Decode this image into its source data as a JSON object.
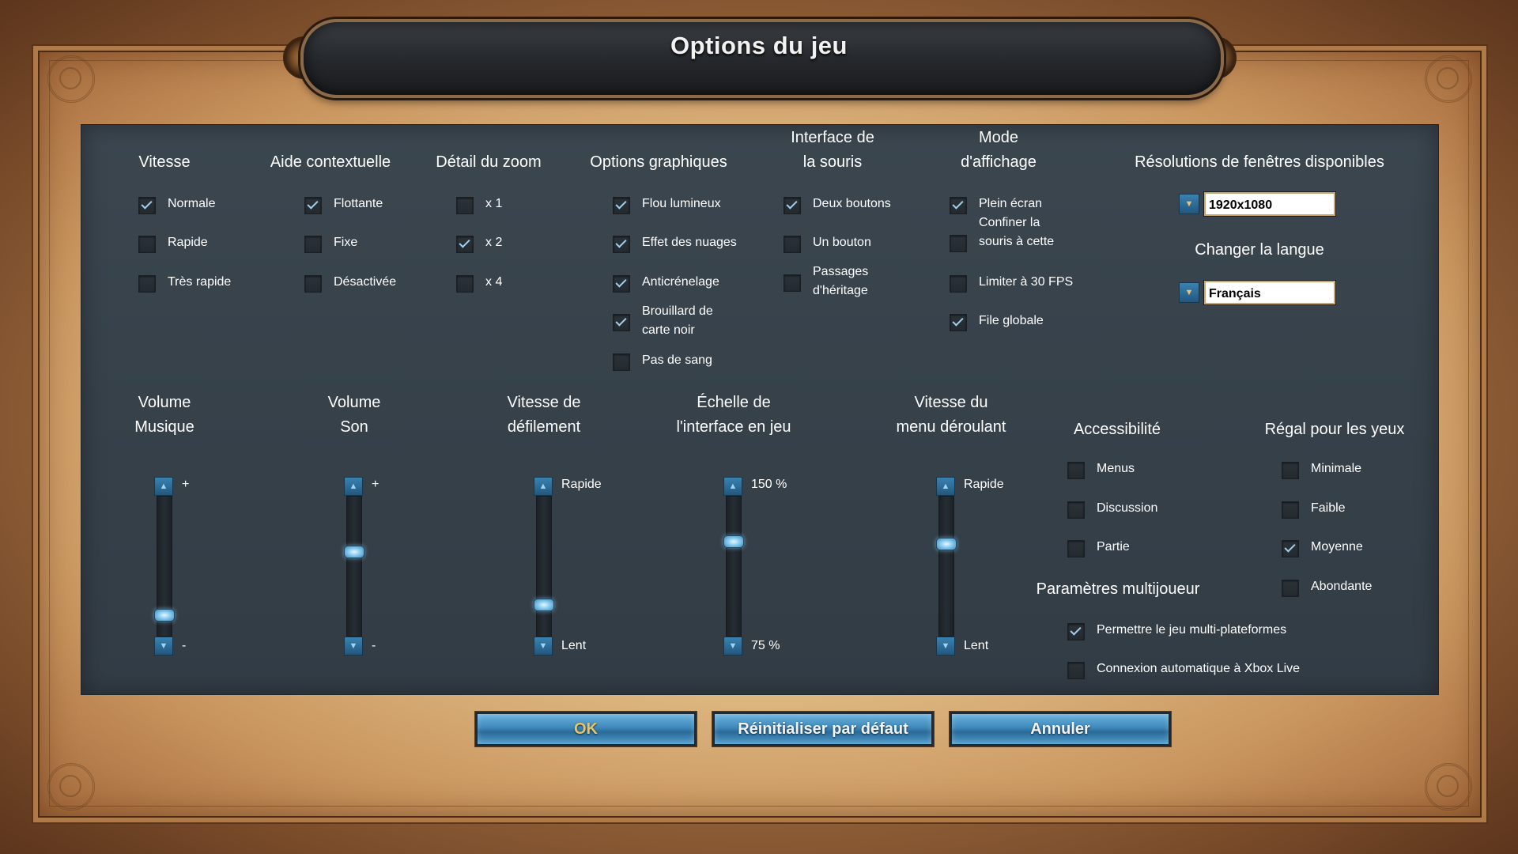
{
  "title": "Options du jeu",
  "columns": {
    "vitesse": {
      "header": "Vitesse",
      "options": [
        {
          "label": "Normale",
          "checked": true
        },
        {
          "label": "Rapide",
          "checked": false
        },
        {
          "label": "Très rapide",
          "checked": false
        }
      ]
    },
    "aide": {
      "header": "Aide contextuelle",
      "options": [
        {
          "label": "Flottante",
          "checked": true
        },
        {
          "label": "Fixe",
          "checked": false
        },
        {
          "label": "Désactivée",
          "checked": false
        }
      ]
    },
    "zoom": {
      "header": "Détail du zoom",
      "options": [
        {
          "label": "x 1",
          "checked": false
        },
        {
          "label": "x 2",
          "checked": true
        },
        {
          "label": "x 4",
          "checked": false
        }
      ]
    },
    "graphiques": {
      "header": "Options graphiques",
      "options": [
        {
          "label": "Flou lumineux",
          "checked": true
        },
        {
          "label": "Effet des nuages",
          "checked": true
        },
        {
          "label": "Anticrénelage",
          "checked": true
        },
        {
          "label": "Brouillard de\ncarte noir",
          "checked": true
        },
        {
          "label": "Pas de sang",
          "checked": false
        }
      ]
    },
    "souris": {
      "header": "Interface de\nla souris",
      "options": [
        {
          "label": "Deux boutons",
          "checked": true
        },
        {
          "label": "Un bouton",
          "checked": false
        },
        {
          "label": "Passages\nd'héritage",
          "checked": false
        }
      ]
    },
    "affichage": {
      "header": "Mode\nd'affichage",
      "options": [
        {
          "label": "Plein écran",
          "checked": true
        },
        {
          "label": "Confiner la\nsouris à cette",
          "checked": false
        },
        {
          "label": "Limiter à 30 FPS",
          "checked": false
        },
        {
          "label": "File globale",
          "checked": true
        }
      ]
    }
  },
  "resolutions": {
    "header": "Résolutions de fenêtres disponibles",
    "value": "1920x1080"
  },
  "langue": {
    "header": "Changer la langue",
    "value": "Français"
  },
  "sliders": [
    {
      "header": "Volume\nMusique",
      "top_label": "+",
      "bottom_label": "-",
      "level": 0.12
    },
    {
      "header": "Volume\nSon",
      "top_label": "+",
      "bottom_label": "-",
      "level": 0.62
    },
    {
      "header": "Vitesse de\ndéfilement",
      "top_label": "Rapide",
      "bottom_label": "Lent",
      "level": 0.2
    },
    {
      "header": "Échelle de\nl'interface en jeu",
      "top_label": "150 %",
      "bottom_label": "75 %",
      "level": 0.7
    },
    {
      "header": "Vitesse du\nmenu déroulant",
      "top_label": "Rapide",
      "bottom_label": "Lent",
      "level": 0.68
    }
  ],
  "accessibilite": {
    "header": "Accessibilité",
    "options": [
      {
        "label": "Menus",
        "checked": false
      },
      {
        "label": "Discussion",
        "checked": false
      },
      {
        "label": "Partie",
        "checked": false
      }
    ]
  },
  "regal": {
    "header": "Régal pour les  yeux",
    "options": [
      {
        "label": "Minimale",
        "checked": false
      },
      {
        "label": "Faible",
        "checked": false
      },
      {
        "label": "Moyenne",
        "checked": true
      },
      {
        "label": "Abondante",
        "checked": false
      }
    ]
  },
  "multijoueur": {
    "header": "Paramètres multijoueur",
    "options": [
      {
        "label": "Permettre le jeu multi-plateformes",
        "checked": true
      },
      {
        "label": "Connexion automatique à Xbox Live",
        "checked": false
      }
    ]
  },
  "buttons": {
    "ok": "OK",
    "reset": "Réinitialiser par défaut",
    "cancel": "Annuler"
  }
}
